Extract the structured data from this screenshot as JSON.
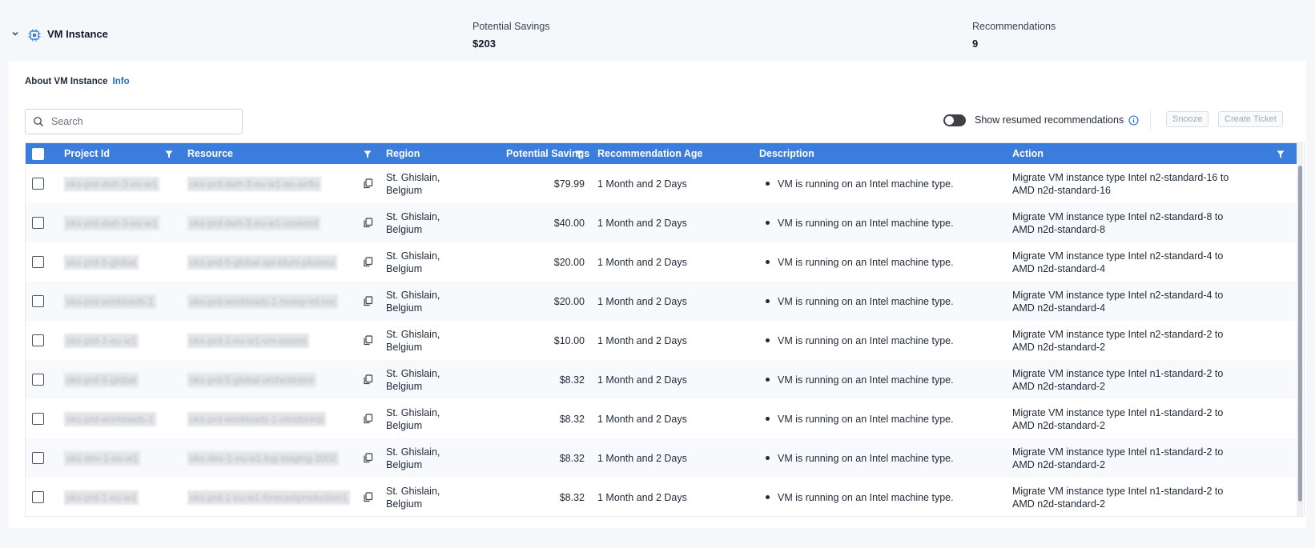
{
  "header": {
    "title": "VM Instance",
    "stats": [
      {
        "label": "Potential Savings",
        "value": "$203"
      },
      {
        "label": "Recommendations",
        "value": "9"
      }
    ]
  },
  "about": {
    "label": "About VM Instance",
    "info_link": "Info"
  },
  "search": {
    "placeholder": "Search"
  },
  "toolbar": {
    "toggle_label": "Show resumed recommendations",
    "snooze_label": "Snooze",
    "create_ticket_label": "Create Ticket"
  },
  "table": {
    "columns": [
      "Project Id",
      "Resource",
      "Region",
      "Potential Savings",
      "Recommendation Age",
      "Description",
      "Action"
    ],
    "rows": [
      {
        "project": "oks-prd-dwh-3-eu-w1",
        "resource": "oks-prd-dwh-3-eu-w1-ao-airflo",
        "region1": "St. Ghislain,",
        "region2": "Belgium",
        "savings": "$79.99",
        "age": "1 Month and 2 Days",
        "description": "VM is running on an Intel machine type.",
        "action1": "Migrate VM instance type Intel n2-standard-16 to",
        "action2": "AMD n2d-standard-16"
      },
      {
        "project": "oks-prd-dwh-3-eu-w1",
        "resource": "oks-prd-dwh-3-eu-w1-covered",
        "region1": "St. Ghislain,",
        "region2": "Belgium",
        "savings": "$40.00",
        "age": "1 Month and 2 Days",
        "description": "VM is running on an Intel machine type.",
        "action1": "Migrate VM instance type Intel n2-standard-8 to",
        "action2": "AMD n2d-standard-8"
      },
      {
        "project": "oks-prd-5-global",
        "resource": "oks-prd-5-global-api-blum-plusess",
        "region1": "St. Ghislain,",
        "region2": "Belgium",
        "savings": "$20.00",
        "age": "1 Month and 2 Days",
        "description": "VM is running on an Intel machine type.",
        "action1": "Migrate VM instance type Intel n2-standard-4 to",
        "action2": "AMD n2d-standard-4"
      },
      {
        "project": "oks-prd-workloads-1",
        "resource": "oks-prd-workloads-1-heavy-ml-rec",
        "region1": "St. Ghislain,",
        "region2": "Belgium",
        "savings": "$20.00",
        "age": "1 Month and 2 Days",
        "description": "VM is running on an Intel machine type.",
        "action1": "Migrate VM instance type Intel n2-standard-4 to",
        "action2": "AMD n2d-standard-4"
      },
      {
        "project": "oks-prd-1-eu-w1",
        "resource": "oks-prd-1-eu-w1-vm-assets",
        "region1": "St. Ghislain,",
        "region2": "Belgium",
        "savings": "$10.00",
        "age": "1 Month and 2 Days",
        "description": "VM is running on an Intel machine type.",
        "action1": "Migrate VM instance type Intel n2-standard-2 to",
        "action2": "AMD n2d-standard-2"
      },
      {
        "project": "oks-prd-5-global",
        "resource": "oks-prd-5-global-orchestrator",
        "region1": "St. Ghislain,",
        "region2": "Belgium",
        "savings": "$8.32",
        "age": "1 Month and 2 Days",
        "description": "VM is running on an Intel machine type.",
        "action1": "Migrate VM instance type Intel n1-standard-2 to",
        "action2": "AMD n2d-standard-2"
      },
      {
        "project": "oks-prd-workloads-1",
        "resource": "oks-prd-workloads-1-vendorerp",
        "region1": "St. Ghislain,",
        "region2": "Belgium",
        "savings": "$8.32",
        "age": "1 Month and 2 Days",
        "description": "VM is running on an Intel machine type.",
        "action1": "Migrate VM instance type Intel n1-standard-2 to",
        "action2": "AMD n2d-standard-2"
      },
      {
        "project": "oks-dev-1-eu-w1",
        "resource": "oks-dev-1-eu-w1-log-staging-1002",
        "region1": "St. Ghislain,",
        "region2": "Belgium",
        "savings": "$8.32",
        "age": "1 Month and 2 Days",
        "description": "VM is running on an Intel machine type.",
        "action1": "Migrate VM instance type Intel n1-standard-2 to",
        "action2": "AMD n2d-standard-2"
      },
      {
        "project": "oks-prd-1-eu-w1",
        "resource": "oks-prd-1-eu-w1-forecastproduction1",
        "region1": "St. Ghislain,",
        "region2": "Belgium",
        "savings": "$8.32",
        "age": "1 Month and 2 Days",
        "description": "VM is running on an Intel machine type.",
        "action1": "Migrate VM instance type Intel n1-standard-2 to",
        "action2": "AMD n2d-standard-2"
      }
    ]
  },
  "colors": {
    "header_blue": "#3b7ddd",
    "link_blue": "#1f6ed4"
  }
}
